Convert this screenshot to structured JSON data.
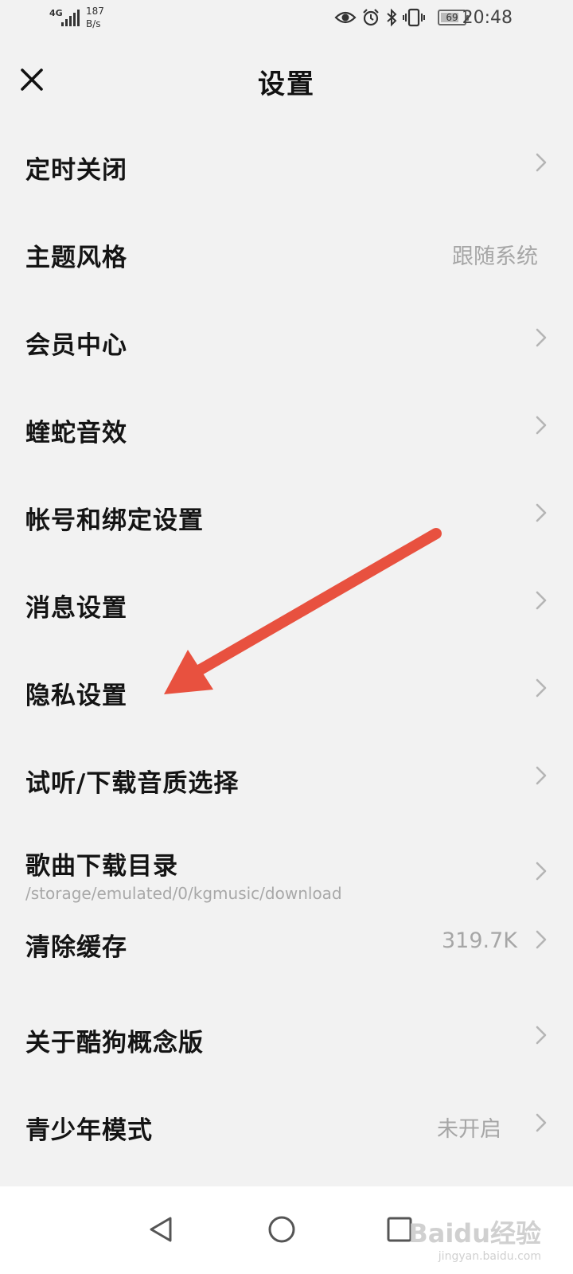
{
  "status_bar": {
    "network": "4G",
    "speed_value": "187",
    "speed_unit": "B/s",
    "battery": "69",
    "time": "20:48"
  },
  "header": {
    "title": "设置"
  },
  "settings": [
    {
      "label": "定时关闭",
      "value": "",
      "chevron": true
    },
    {
      "label": "主题风格",
      "value": "跟随系统",
      "chevron": false
    },
    {
      "label": "会员中心",
      "value": "",
      "chevron": true
    },
    {
      "label": "蝰蛇音效",
      "value": "",
      "chevron": true
    },
    {
      "label": "帐号和绑定设置",
      "value": "",
      "chevron": true
    },
    {
      "label": "消息设置",
      "value": "",
      "chevron": true
    },
    {
      "label": "隐私设置",
      "value": "",
      "chevron": true
    },
    {
      "label": "试听/下载音质选择",
      "value": "",
      "chevron": true
    },
    {
      "label": "歌曲下载目录",
      "sub": "/storage/emulated/0/kgmusic/download",
      "value": "",
      "chevron": true
    },
    {
      "label": "清除缓存",
      "value": "319.7K",
      "chevron": true
    },
    {
      "label": "关于酷狗概念版",
      "value": "",
      "chevron": true
    },
    {
      "label": "青少年模式",
      "value": "未开启",
      "chevron": true
    }
  ],
  "watermark": {
    "text": "Baidu经验",
    "url": "jingyan.baidu.com"
  },
  "colors": {
    "background": "#f2f2f2",
    "annotation_arrow": "#e8513f",
    "secondary_text": "#a6a6a6"
  }
}
